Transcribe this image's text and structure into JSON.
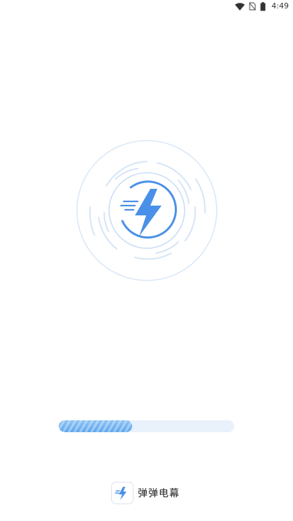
{
  "status_bar": {
    "time": "4:49",
    "icons": [
      "wifi-icon",
      "no-sim-icon",
      "battery-icon"
    ]
  },
  "splash": {
    "illustration_icon": "lightning-bolt-icon",
    "accent_color": "#4a90e8",
    "ring_color": "#d6e6f8"
  },
  "loading": {
    "progress": 0.42,
    "fill_color": "#6aaef0",
    "track_color": "#e9f1fb"
  },
  "brand": {
    "logo_icon": "lightning-bolt-icon",
    "name": "弹弹电幕"
  }
}
